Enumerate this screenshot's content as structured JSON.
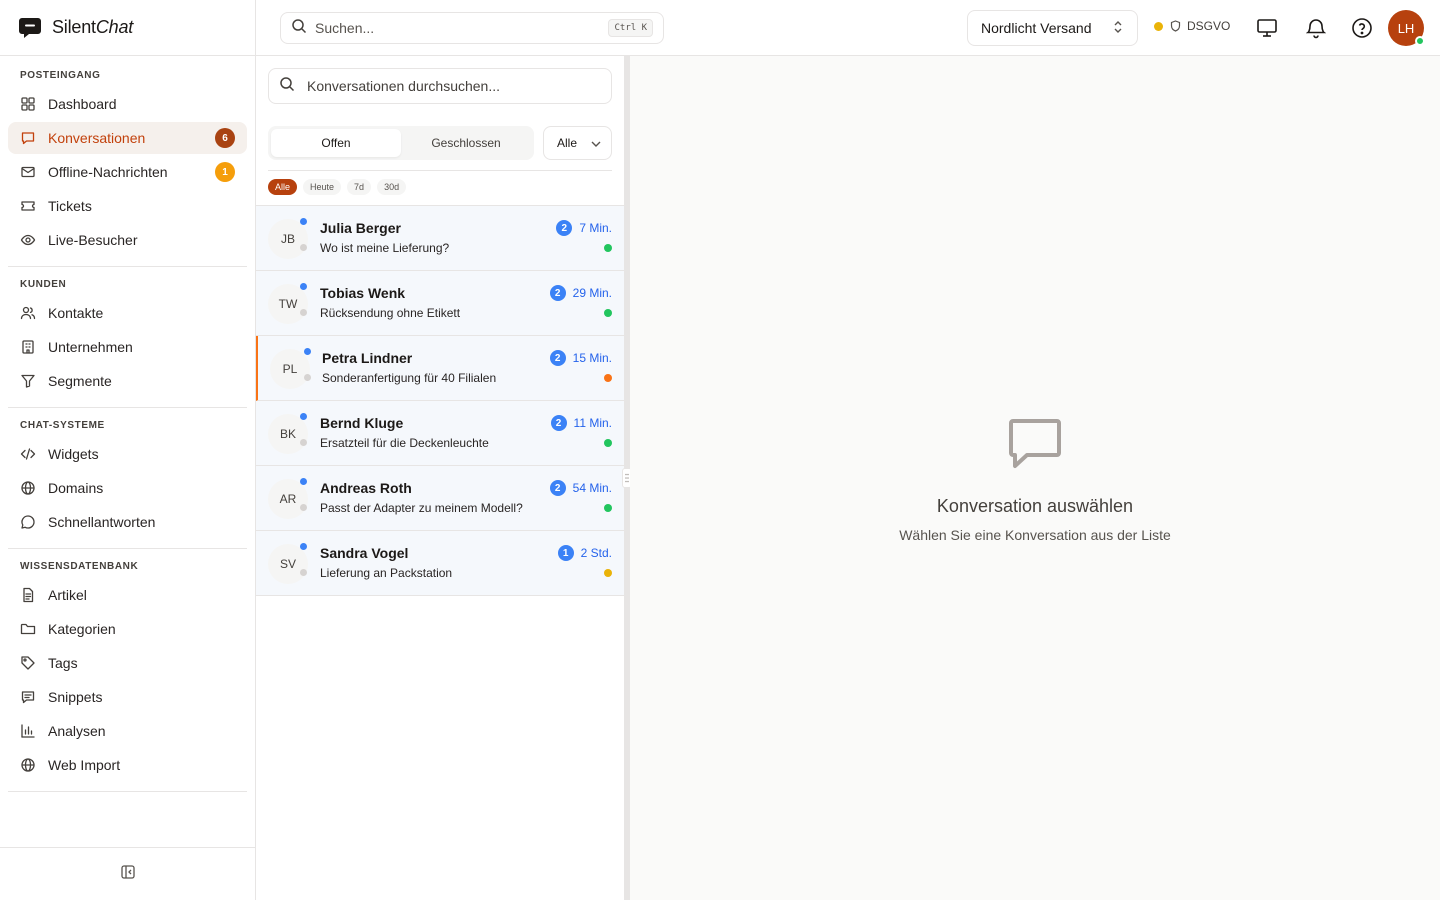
{
  "brand": {
    "name_plain": "Silent",
    "name_italic": "Chat"
  },
  "sidebar": {
    "sections": [
      {
        "title": "POSTEINGANG",
        "items": [
          {
            "label": "Dashboard",
            "icon": "dashboard-icon"
          },
          {
            "label": "Konversationen",
            "icon": "chat-icon",
            "badge": "6",
            "active": true
          },
          {
            "label": "Offline-Nachrichten",
            "icon": "mail-icon",
            "badge": "1"
          },
          {
            "label": "Tickets",
            "icon": "ticket-icon"
          },
          {
            "label": "Live-Besucher",
            "icon": "eye-icon"
          }
        ]
      },
      {
        "title": "KUNDEN",
        "items": [
          {
            "label": "Kontakte",
            "icon": "users-icon"
          },
          {
            "label": "Unternehmen",
            "icon": "building-icon"
          },
          {
            "label": "Segmente",
            "icon": "filter-icon"
          }
        ]
      },
      {
        "title": "CHAT-SYSTEME",
        "items": [
          {
            "label": "Widgets",
            "icon": "code-icon"
          },
          {
            "label": "Domains",
            "icon": "globe-icon"
          },
          {
            "label": "Schnellantworten",
            "icon": "message-circle-icon"
          }
        ]
      },
      {
        "title": "WISSENSDATENBANK",
        "items": [
          {
            "label": "Artikel",
            "icon": "file-text-icon"
          },
          {
            "label": "Kategorien",
            "icon": "folder-icon"
          },
          {
            "label": "Tags",
            "icon": "tag-icon"
          },
          {
            "label": "Snippets",
            "icon": "snippet-icon"
          },
          {
            "label": "Analysen",
            "icon": "bar-chart-icon"
          },
          {
            "label": "Web Import",
            "icon": "globe-icon"
          }
        ]
      }
    ]
  },
  "topbar": {
    "search_placeholder": "Suchen...",
    "shortcut": "Ctrl K",
    "workspace": "Nordlicht Versand",
    "compliance": "DSGVO",
    "user_initials": "LH"
  },
  "list": {
    "search_placeholder": "Konversationen durchsuchen...",
    "tabs": [
      "Offen",
      "Geschlossen"
    ],
    "active_tab": "Offen",
    "filter_value": "Alle",
    "time_chips": [
      "Alle",
      "Heute",
      "7d",
      "30d"
    ],
    "active_chip": "Alle",
    "conversations": [
      {
        "initials": "JB",
        "name": "Julia Berger",
        "subject": "Wo ist meine Lieferung?",
        "count": "2",
        "time": "7 Min.",
        "priority_color": "#22c55e",
        "flagged": false
      },
      {
        "initials": "TW",
        "name": "Tobias Wenk",
        "subject": "Rücksendung ohne Etikett",
        "count": "2",
        "time": "29 Min.",
        "priority_color": "#22c55e",
        "flagged": false
      },
      {
        "initials": "PL",
        "name": "Petra Lindner",
        "subject": "Sonderanfertigung für 40 Filialen",
        "count": "2",
        "time": "15 Min.",
        "priority_color": "#f97316",
        "flagged": true
      },
      {
        "initials": "BK",
        "name": "Bernd Kluge",
        "subject": "Ersatzteil für die Deckenleuchte",
        "count": "2",
        "time": "11 Min.",
        "priority_color": "#22c55e",
        "flagged": false
      },
      {
        "initials": "AR",
        "name": "Andreas Roth",
        "subject": "Passt der Adapter zu meinem Modell?",
        "count": "2",
        "time": "54 Min.",
        "priority_color": "#22c55e",
        "flagged": false
      },
      {
        "initials": "SV",
        "name": "Sandra Vogel",
        "subject": "Lieferung an Packstation",
        "count": "1",
        "time": "2 Std.",
        "priority_color": "#eab308",
        "flagged": false
      }
    ]
  },
  "detail": {
    "empty_title": "Konversation auswählen",
    "empty_subtitle": "Wählen Sie eine Konversation aus der Liste"
  }
}
